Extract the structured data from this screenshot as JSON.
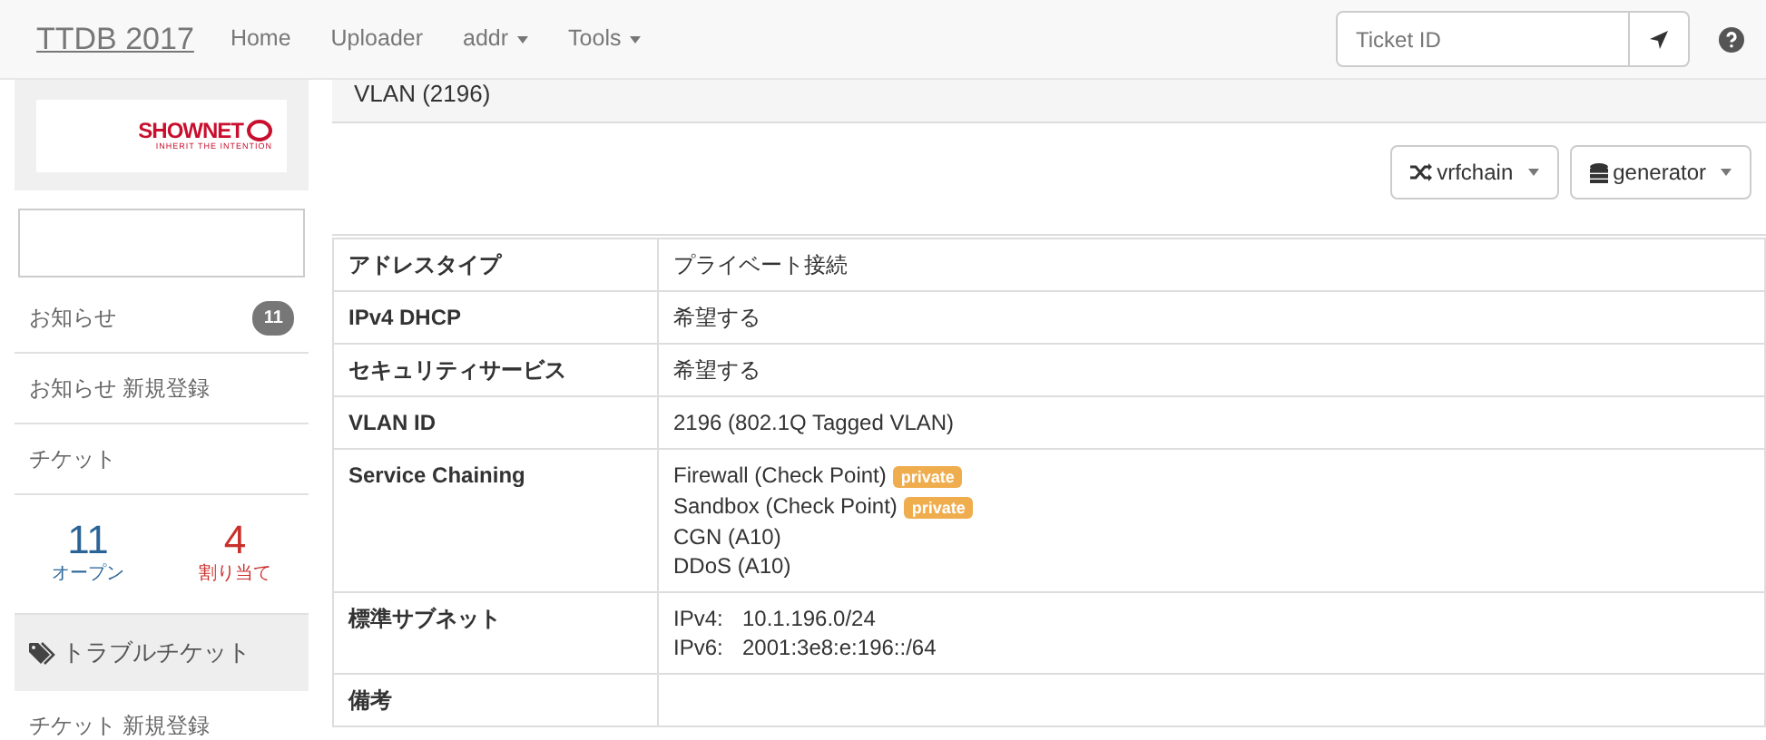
{
  "navbar": {
    "brand": "TTDB 2017",
    "links": [
      {
        "label": "Home",
        "dropdown": false
      },
      {
        "label": "Uploader",
        "dropdown": false
      },
      {
        "label": "addr",
        "dropdown": true
      },
      {
        "label": "Tools",
        "dropdown": true
      }
    ],
    "search": {
      "placeholder": "Ticket ID"
    }
  },
  "sidebar": {
    "logo": {
      "name": "SHOWNET",
      "tagline": "INHERIT THE INTENTION"
    },
    "items": [
      {
        "kind": "link",
        "label": "お知らせ",
        "badge": "11"
      },
      {
        "kind": "link",
        "label": "お知らせ 新規登録"
      },
      {
        "kind": "link",
        "label": "チケット"
      },
      {
        "kind": "stats",
        "stats": [
          {
            "value": "11",
            "label": "オープン",
            "color": "#2a6496"
          },
          {
            "value": "4",
            "label": "割り当て",
            "color": "#c9302c"
          }
        ]
      },
      {
        "kind": "header",
        "label": "トラブルチケット"
      },
      {
        "kind": "link",
        "label": "チケット 新規登録"
      }
    ]
  },
  "panel": {
    "title": "VLAN (2196)",
    "buttons": [
      {
        "label": "vrfchain"
      },
      {
        "label": "generator"
      }
    ],
    "rows": [
      {
        "kind": "text",
        "label": "アドレスタイプ",
        "value": "プライベート接続"
      },
      {
        "kind": "text",
        "label": "IPv4 DHCP",
        "value": "希望する"
      },
      {
        "kind": "text",
        "label": "セキュリティサービス",
        "value": "希望する"
      },
      {
        "kind": "text",
        "label": "VLAN ID",
        "value": "2196 (802.1Q Tagged VLAN)"
      },
      {
        "kind": "list",
        "label": "Service Chaining",
        "items": [
          {
            "text": "Firewall (Check Point)",
            "tag": "private"
          },
          {
            "text": "Sandbox (Check Point)",
            "tag": "private"
          },
          {
            "text": "CGN (A10)"
          },
          {
            "text": "DDoS (A10)"
          }
        ]
      },
      {
        "kind": "pairs",
        "label": "標準サブネット",
        "pairs": [
          {
            "key": "IPv4:",
            "value": "10.1.196.0/24"
          },
          {
            "key": "IPv6:",
            "value": "2001:3e8:e:196::/64"
          }
        ]
      },
      {
        "kind": "text",
        "label": "備考",
        "value": ""
      }
    ]
  }
}
